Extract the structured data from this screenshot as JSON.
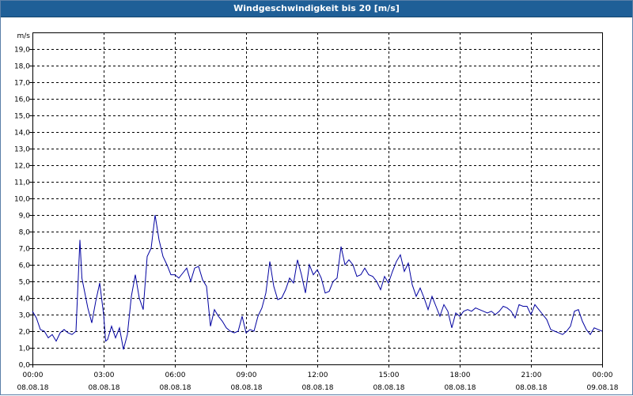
{
  "window": {
    "title": "Windgeschwindigkeit bis 20 [m/s]"
  },
  "colors": {
    "title_bar": "#1f5f97",
    "series_line": "#0000a0",
    "grid": "#000000",
    "background": "#ffffff"
  },
  "chart_data": {
    "type": "line",
    "title": "Windgeschwindigkeit bis 20 [m/s]",
    "ylabel": "m/s",
    "xlabel": "",
    "ylim": [
      0,
      20
    ],
    "xlim": [
      "2018-08-08 00:00",
      "2018-08-09 00:00"
    ],
    "grid": true,
    "y_ticks": [
      "0,0",
      "1,0",
      "2,0",
      "3,0",
      "4,0",
      "5,0",
      "6,0",
      "7,0",
      "8,0",
      "9,0",
      "10,0",
      "11,0",
      "12,0",
      "13,0",
      "14,0",
      "15,0",
      "16,0",
      "17,0",
      "18,0",
      "19,0"
    ],
    "x_ticks": [
      {
        "time": "00:00",
        "date": "08.08.18"
      },
      {
        "time": "03:00",
        "date": "08.08.18"
      },
      {
        "time": "06:00",
        "date": "08.08.18"
      },
      {
        "time": "09:00",
        "date": "08.08.18"
      },
      {
        "time": "12:00",
        "date": "08.08.18"
      },
      {
        "time": "15:00",
        "date": "08.08.18"
      },
      {
        "time": "18:00",
        "date": "08.08.18"
      },
      {
        "time": "21:00",
        "date": "08.08.18"
      },
      {
        "time": "00:00",
        "date": "09.08.18"
      }
    ],
    "series": [
      {
        "x": [
          "00:00",
          "00:10",
          "00:20",
          "00:30",
          "00:40",
          "00:50",
          "01:00",
          "01:10",
          "01:20",
          "01:30",
          "01:40",
          "01:50",
          "02:00",
          "02:05",
          "02:10",
          "02:20",
          "02:30",
          "02:40",
          "02:50",
          "03:00",
          "03:05",
          "03:10",
          "03:20",
          "03:30",
          "03:40",
          "03:50",
          "04:00",
          "04:10",
          "04:20",
          "04:30",
          "04:40",
          "04:50",
          "05:00",
          "05:10",
          "05:20",
          "05:30",
          "05:40",
          "05:50",
          "06:00",
          "06:10",
          "06:20",
          "06:30",
          "06:40",
          "06:50",
          "07:00",
          "07:10",
          "07:20",
          "07:30",
          "07:40",
          "07:50",
          "08:00",
          "08:10",
          "08:20",
          "08:30",
          "08:40",
          "08:50",
          "09:00",
          "09:10",
          "09:20",
          "09:30",
          "09:40",
          "09:50",
          "10:00",
          "10:10",
          "10:20",
          "10:30",
          "10:40",
          "10:50",
          "11:00",
          "11:10",
          "11:20",
          "11:30",
          "11:40",
          "11:50",
          "12:00",
          "12:10",
          "12:20",
          "12:30",
          "12:40",
          "12:50",
          "13:00",
          "13:10",
          "13:20",
          "13:30",
          "13:40",
          "13:50",
          "14:00",
          "14:10",
          "14:20",
          "14:30",
          "14:40",
          "14:50",
          "15:00",
          "15:10",
          "15:20",
          "15:30",
          "15:40",
          "15:50",
          "16:00",
          "16:10",
          "16:20",
          "16:30",
          "16:40",
          "16:50",
          "17:00",
          "17:10",
          "17:20",
          "17:30",
          "17:40",
          "17:50",
          "18:00",
          "18:10",
          "18:20",
          "18:30",
          "18:40",
          "18:50",
          "19:00",
          "19:10",
          "19:20",
          "19:30",
          "19:40",
          "19:50",
          "20:00",
          "20:10",
          "20:20",
          "20:30",
          "20:40",
          "20:50",
          "21:00",
          "21:10",
          "21:20",
          "21:30",
          "21:40",
          "21:50",
          "22:00",
          "22:10",
          "22:20",
          "22:30",
          "22:40",
          "22:50",
          "23:00",
          "23:10",
          "23:20",
          "23:30",
          "23:40",
          "23:50",
          "24:00"
        ],
        "values": [
          3.2,
          2.8,
          2.1,
          2.0,
          1.6,
          1.8,
          1.4,
          1.9,
          2.1,
          1.9,
          1.8,
          2.0,
          7.5,
          5.2,
          4.6,
          3.4,
          2.5,
          3.8,
          4.9,
          3.0,
          1.4,
          1.5,
          2.3,
          1.6,
          2.2,
          0.9,
          1.8,
          4.1,
          5.4,
          4.0,
          3.3,
          6.5,
          7.0,
          9.0,
          7.5,
          6.5,
          6.0,
          5.4,
          5.4,
          5.2,
          5.5,
          5.8,
          5.0,
          5.8,
          5.9,
          5.1,
          4.7,
          2.3,
          3.3,
          2.9,
          2.6,
          2.2,
          2.0,
          1.9,
          2.0,
          2.9,
          1.9,
          2.1,
          2.0,
          2.9,
          3.4,
          4.3,
          6.2,
          4.7,
          3.9,
          4.0,
          4.5,
          5.2,
          4.9,
          6.3,
          5.4,
          4.3,
          6.0,
          5.4,
          5.7,
          5.2,
          4.3,
          4.4,
          5.0,
          5.2,
          7.1,
          6.0,
          6.3,
          6.0,
          5.3,
          5.4,
          5.8,
          5.4,
          5.3,
          5.0,
          4.5,
          5.3,
          4.9,
          5.6,
          6.2,
          6.6,
          5.6,
          6.1,
          4.8,
          4.1,
          4.6,
          4.0,
          3.3,
          4.1,
          3.5,
          2.9,
          3.6,
          3.2,
          2.2,
          3.1,
          2.9,
          3.2,
          3.3,
          3.2,
          3.4,
          3.3,
          3.2,
          3.1,
          3.2,
          3.0,
          3.2,
          3.5,
          3.4,
          3.2,
          2.8,
          3.6,
          3.5,
          3.5,
          3.0,
          3.6,
          3.3,
          3.0,
          2.7,
          2.1,
          2.0,
          1.9,
          1.8,
          2.0,
          2.3,
          3.2,
          3.3,
          2.6,
          2.1,
          1.8,
          2.2,
          2.1,
          2.0
        ]
      }
    ]
  }
}
